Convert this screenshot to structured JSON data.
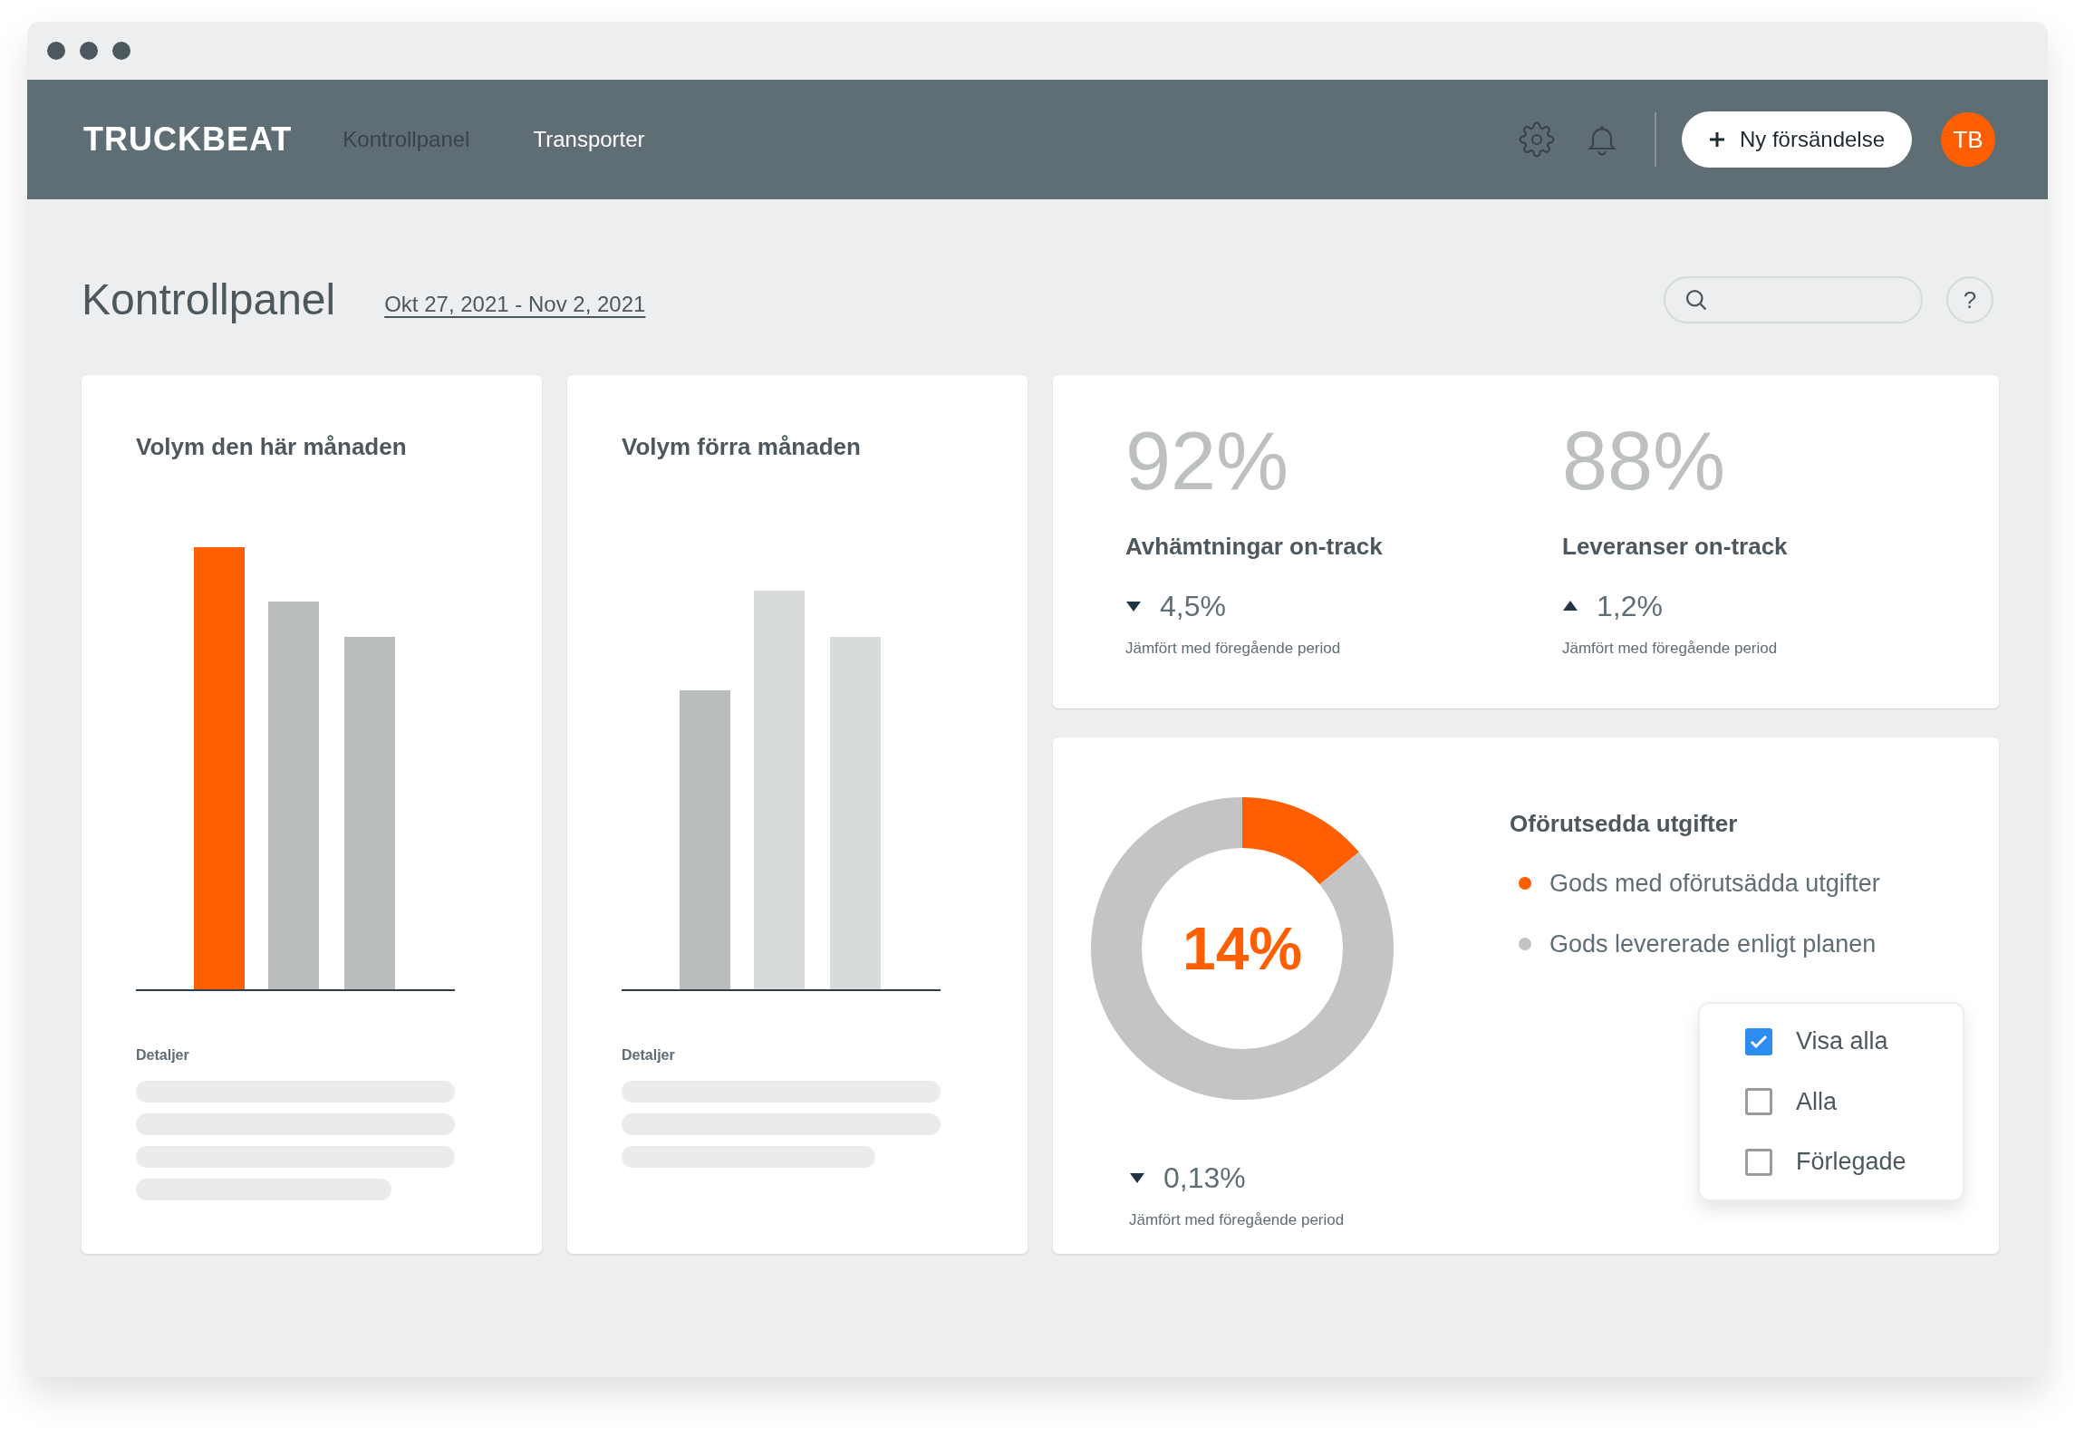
{
  "nav": {
    "logo": "TRUCKBEAT",
    "items": [
      {
        "label": "Kontrollpanel",
        "selected": true
      },
      {
        "label": "Transporter",
        "selected": false
      }
    ],
    "new_button": "Ny försändelse",
    "avatar": "TB"
  },
  "page": {
    "title": "Kontrollpanel",
    "date_range": "Okt 27, 2021 - Nov 2, 2021",
    "help": "?"
  },
  "volume_cards": [
    {
      "title": "Volym den här månaden",
      "details_label": "Detaljer"
    },
    {
      "title": "Volym förra månaden",
      "details_label": "Detaljer"
    }
  ],
  "kpis": [
    {
      "value": "92%",
      "label": "Avhämtningar on-track",
      "decrease": true,
      "change": "4,5%",
      "comparison": "Jämfört med föregående period"
    },
    {
      "value": "88%",
      "label": "Leveranser on-track",
      "decrease": false,
      "change": "1,2%",
      "comparison": "Jämfört med föregående period"
    }
  ],
  "expenses": {
    "chart_data": {
      "type": "donut",
      "title": "Oförutsedda utgifter",
      "categories": [
        "Gods med oförutsädda utgifter",
        "Gods levererade enligt planen"
      ],
      "values": [
        14,
        86
      ],
      "colors": [
        "#ff5f00",
        "#c4c4c4"
      ],
      "legend": "right"
    },
    "center_label": "14%",
    "decrease": true,
    "change": "0,13%",
    "comparison": "Jämfört med föregående period",
    "filters": [
      {
        "label": "Visa alla",
        "checked": true
      },
      {
        "label": "Alla",
        "checked": false
      },
      {
        "label": "Förlegade",
        "checked": false
      }
    ]
  }
}
